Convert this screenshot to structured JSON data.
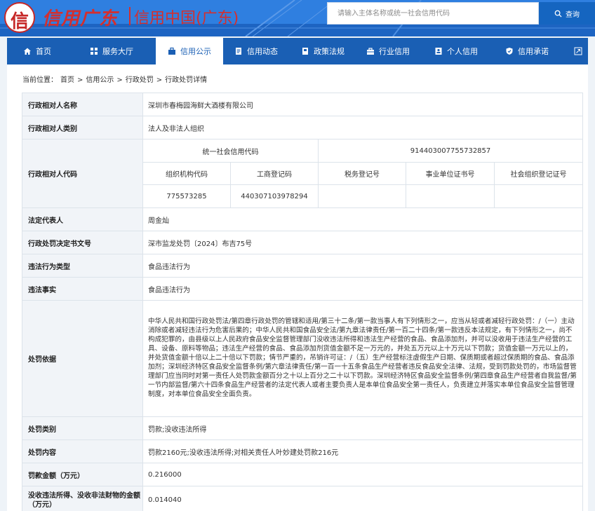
{
  "header": {
    "emblem_char": "信",
    "logo_script": "信用广东",
    "title": "信用中国(广东)",
    "search_placeholder": "请输入主体名称或统一社会信用代码",
    "search_button": "查询"
  },
  "nav": {
    "items": [
      {
        "label": "首页",
        "icon": "home-icon",
        "active": false
      },
      {
        "label": "服务大厅",
        "icon": "grid-icon",
        "active": false
      },
      {
        "label": "信用公示",
        "icon": "bag-icon",
        "active": true
      },
      {
        "label": "信用动态",
        "icon": "document-icon",
        "active": false
      },
      {
        "label": "政策法规",
        "icon": "book-icon",
        "active": false
      },
      {
        "label": "行业信用",
        "icon": "briefcase-icon",
        "active": false
      },
      {
        "label": "个人信用",
        "icon": "id-card-icon",
        "active": false
      },
      {
        "label": "信用承诺",
        "icon": "shield-icon",
        "active": false
      }
    ],
    "extra_icon": "expand-icon"
  },
  "breadcrumb": {
    "prefix": "当前位置：",
    "items": [
      "首页",
      ">",
      "信用公示",
      ">",
      "行政处罚",
      ">",
      "行政处罚详情"
    ]
  },
  "detail": {
    "name_label": "行政相对人名称",
    "name_value": "深圳市春梅园海鲜大酒楼有限公司",
    "category_label": "行政相对人类别",
    "category_value": "法人及非法人组织",
    "code_label": "行政相对人代码",
    "uscc_label": "统一社会信用代码",
    "uscc_value": "914403007755732857",
    "code_headers": [
      "组织机构代码",
      "工商登记码",
      "税务登记号",
      "事业单位证书号",
      "社会组织登记证号"
    ],
    "code_values": [
      "775573285",
      "440307103978294",
      "",
      "",
      ""
    ],
    "legal_rep_label": "法定代表人",
    "legal_rep_value": "周金灿",
    "decision_no_label": "行政处罚决定书文号",
    "decision_no_value": "深市监龙处罚〔2024〕布吉75号",
    "violation_type_label": "违法行为类型",
    "violation_type_value": "食品违法行为",
    "violation_fact_label": "违法事实",
    "violation_fact_value": "食品违法行为",
    "basis_label": "处罚依据",
    "basis_value": "中华人民共和国行政处罚法/第四章行政处罚的管辖和适用/第三十二条/第一款当事人有下列情形之一，应当从轻或者减轻行政处罚：/（一）主动消除或者减轻违法行为危害后果的；中华人民共和国食品安全法/第九章法律责任/第一百二十四条/第一款违反本法规定，有下列情形之一，尚不构成犯罪的，由县级以上人民政府食品安全监督管理部门没收违法所得和违法生产经营的食品、食品添加剂，并可以没收用于违法生产经营的工具、设备、原料等物品；违法生产经营的食品、食品添加剂货值金额不足一万元的，并处五万元以上十万元以下罚款；货值金额一万元以上的，并处货值金额十倍以上二十倍以下罚款；情节严重的，吊销许可证：/（五）生产经营标注虚假生产日期、保质期或者超过保质期的食品、食品添加剂；深圳经济特区食品安全监督条例/第六章法律责任/第一百一十五条食品生产经营者违反食品安全法律、法规，受到罚款处罚的，市场监督管理部门应当同时对第一责任人处罚款金额百分之十以上百分之二十以下罚款。深圳经济特区食品安全监督条例/第四章食品生产经营者自我监督/第一节内部监督/第六十四条食品生产经营者的法定代表人或者主要负责人是本单位食品安全第一责任人，负责建立并落实本单位食品安全监督管理制度，对本单位食品安全全面负责。",
    "penalty_type_label": "处罚类别",
    "penalty_type_value": "罚款;没收违法所得",
    "penalty_content_label": "处罚内容",
    "penalty_content_value": "罚款2160元;没收违法所得;对相关责任人叶妙建处罚款216元",
    "fine_label": "罚款金额（万元）",
    "fine_value": "0.216000",
    "confiscation_label": "没收违法所得、没收非法财物的金额（万元）",
    "confiscation_value": "0.014040"
  },
  "colors": {
    "header_blue": "#1f6fd1",
    "nav_blue": "#1a5fb4",
    "logo_red": "#d32f2f",
    "label_bg": "#f1f4f8"
  }
}
